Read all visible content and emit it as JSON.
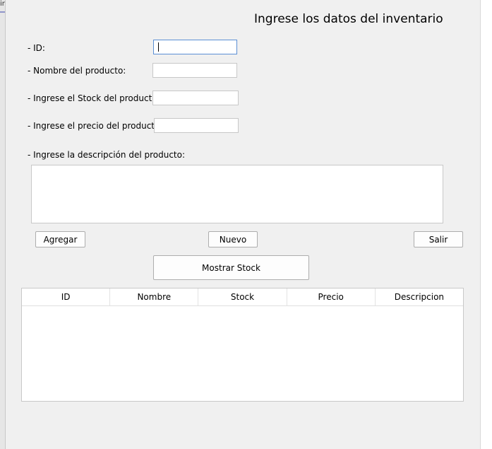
{
  "left_edge_text": "ir",
  "form": {
    "title": "Ingrese los datos del inventario",
    "fields": {
      "id": {
        "label": "- ID:",
        "value": ""
      },
      "nombre": {
        "label": "- Nombre del producto:",
        "value": ""
      },
      "stock": {
        "label": "- Ingrese el Stock del producto:",
        "value": ""
      },
      "precio": {
        "label": "- Ingrese el precio del producto",
        "value": ""
      },
      "descripcion": {
        "label": "- Ingrese la descripción del producto:",
        "value": ""
      }
    },
    "buttons": {
      "agregar": "Agregar",
      "nuevo": "Nuevo",
      "salir": "Salir",
      "mostrar_stock": "Mostrar Stock"
    },
    "table": {
      "columns": [
        "ID",
        "Nombre",
        "Stock",
        "Precio",
        "Descripcion"
      ],
      "rows": []
    }
  }
}
